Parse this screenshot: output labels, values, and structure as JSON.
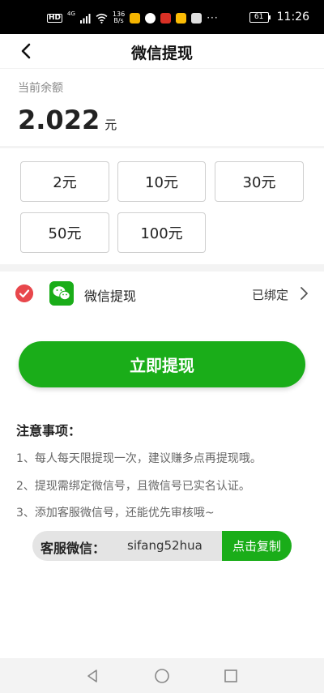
{
  "status_bar": {
    "hd": "HD",
    "network": "4G",
    "speed_value": "136",
    "speed_unit": "B/s",
    "more": "···",
    "battery": "61",
    "time": "11:26"
  },
  "nav": {
    "title": "微信提现"
  },
  "balance": {
    "label": "当前余额",
    "amount": "2.022",
    "unit": "元"
  },
  "amounts": [
    "2元",
    "10元",
    "30元",
    "50元",
    "100元"
  ],
  "wechat": {
    "label": "微信提现",
    "status": "已绑定"
  },
  "withdraw_button": "立即提现",
  "notes": {
    "title": "注意事项：",
    "items": [
      "1、每人每天限提现一次，建议赚多点再提现哦。",
      "2、提现需绑定微信号，且微信号已实名认证。",
      "3、添加客服微信号，还能优先审核哦~"
    ]
  },
  "service": {
    "label": "客服微信：",
    "wechat_id": "sifang52hua",
    "copy_label": "点击复制"
  },
  "colors": {
    "accent": "#1aad19",
    "check": "#e8474c"
  }
}
